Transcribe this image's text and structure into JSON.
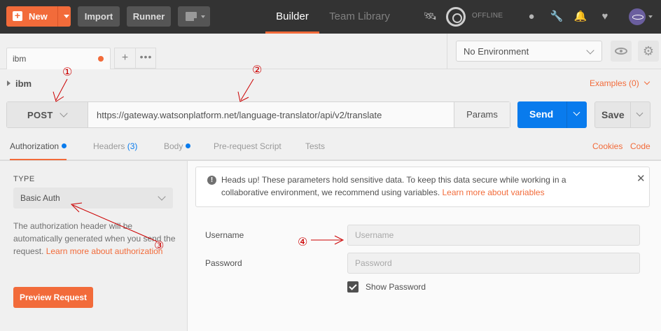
{
  "header": {
    "new_label": "New",
    "import_label": "Import",
    "runner_label": "Runner",
    "nav_builder": "Builder",
    "nav_team_library": "Team Library",
    "offline_label": "OFFLINE"
  },
  "tabs": {
    "request_tab_name": "ibm"
  },
  "environment": {
    "selected": "No Environment"
  },
  "request": {
    "collection_name": "ibm",
    "examples_label": "Examples (0)",
    "method": "POST",
    "url": "https://gateway.watsonplatform.net/language-translator/api/v2/translate",
    "params_label": "Params",
    "send_label": "Send",
    "save_label": "Save"
  },
  "subtabs": {
    "authorization": "Authorization",
    "headers": "Headers",
    "headers_count": "(3)",
    "body": "Body",
    "pre_request": "Pre-request Script",
    "tests": "Tests",
    "cookies": "Cookies",
    "code": "Code"
  },
  "auth": {
    "type_label": "TYPE",
    "type_value": "Basic Auth",
    "description": "The authorization header will be automatically generated when you send the request.",
    "learn_more": "Learn more about authorization",
    "preview_label": "Preview Request"
  },
  "notice": {
    "text": "Heads up! These parameters hold sensitive data. To keep this data secure while working in a collaborative environment, we recommend using variables.",
    "link": "Learn more about variables"
  },
  "form": {
    "username_label": "Username",
    "username_placeholder": "Username",
    "password_label": "Password",
    "password_placeholder": "Password",
    "show_password_label": "Show Password"
  },
  "annotations": {
    "a1": "①",
    "a2": "②",
    "a3": "③",
    "a4": "④"
  },
  "colors": {
    "accent": "#f26b3a",
    "send_blue": "#097bed",
    "header_bg": "#333333"
  }
}
